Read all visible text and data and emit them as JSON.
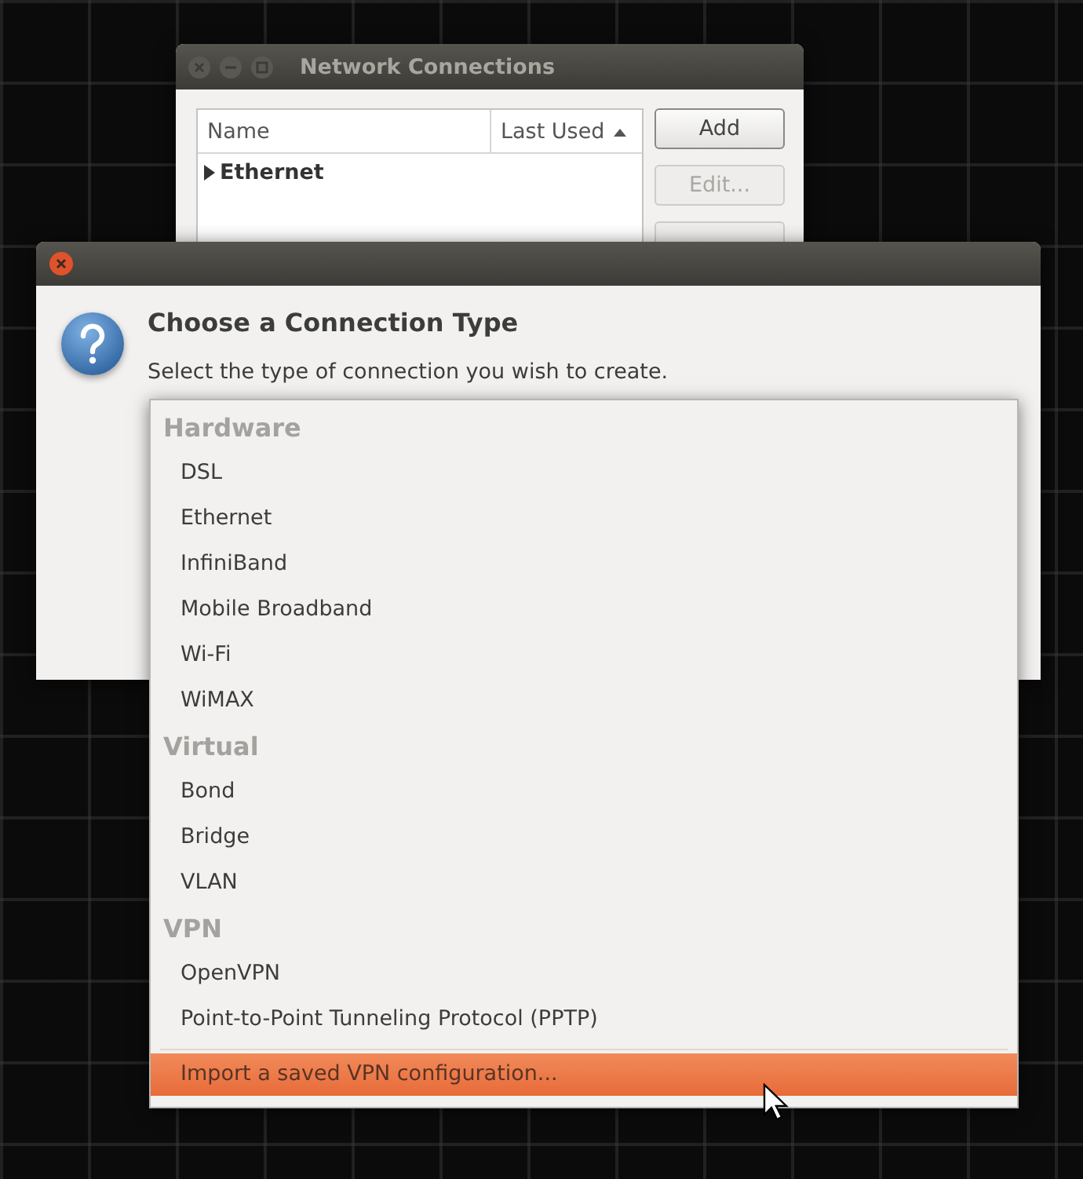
{
  "back_window": {
    "title": "Network Connections",
    "columns": [
      {
        "label": "Name",
        "sorted": false
      },
      {
        "label": "Last Used",
        "sorted": true
      }
    ],
    "rows": [
      {
        "label": "Ethernet",
        "expanded": false
      }
    ],
    "buttons": [
      {
        "label": "Add",
        "disabled": false
      },
      {
        "label": "Edit...",
        "disabled": true
      },
      {
        "disabled": true
      }
    ]
  },
  "dialog": {
    "heading": "Choose a Connection Type",
    "subtitle": "Select the type of connection you wish to create."
  },
  "menu": {
    "groups": [
      {
        "label": "Hardware",
        "items": [
          {
            "label": "DSL",
            "selected": false
          },
          {
            "label": "Ethernet",
            "selected": false
          },
          {
            "label": "InfiniBand",
            "selected": false
          },
          {
            "label": "Mobile Broadband",
            "selected": false
          },
          {
            "label": "Wi-Fi",
            "selected": false
          },
          {
            "label": "WiMAX",
            "selected": false
          }
        ]
      },
      {
        "label": "Virtual",
        "items": [
          {
            "label": "Bond",
            "selected": false
          },
          {
            "label": "Bridge",
            "selected": false
          },
          {
            "label": "VLAN",
            "selected": false
          }
        ]
      },
      {
        "label": "VPN",
        "items": [
          {
            "label": "OpenVPN",
            "selected": false
          },
          {
            "label": "Point-to-Point Tunneling Protocol (PPTP)",
            "selected": false
          }
        ]
      }
    ],
    "footer": {
      "label": "Import a saved VPN configuration...",
      "selected": true
    }
  }
}
